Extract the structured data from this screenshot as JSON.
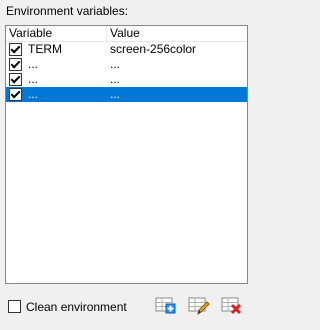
{
  "group_label": "Environment variables:",
  "table": {
    "headers": [
      "Variable",
      "Value"
    ],
    "rows": [
      {
        "checked": true,
        "variable": "TERM",
        "value": "screen-256color"
      },
      {
        "checked": true,
        "variable": "...",
        "value": "..."
      },
      {
        "checked": true,
        "variable": "...",
        "value": "..."
      },
      {
        "checked": true,
        "variable": "...",
        "value": "...",
        "selected": true
      }
    ]
  },
  "clean_environment": {
    "label": "Clean environment",
    "checked": false
  },
  "toolbar": {
    "add_icon": "add-table-row-icon",
    "edit_icon": "edit-table-row-icon",
    "delete_icon": "delete-table-row-icon"
  },
  "colors": {
    "selection": "#0078d7",
    "add": "#1e90ff",
    "edit": "#f5a623",
    "delete": "#e02020"
  }
}
